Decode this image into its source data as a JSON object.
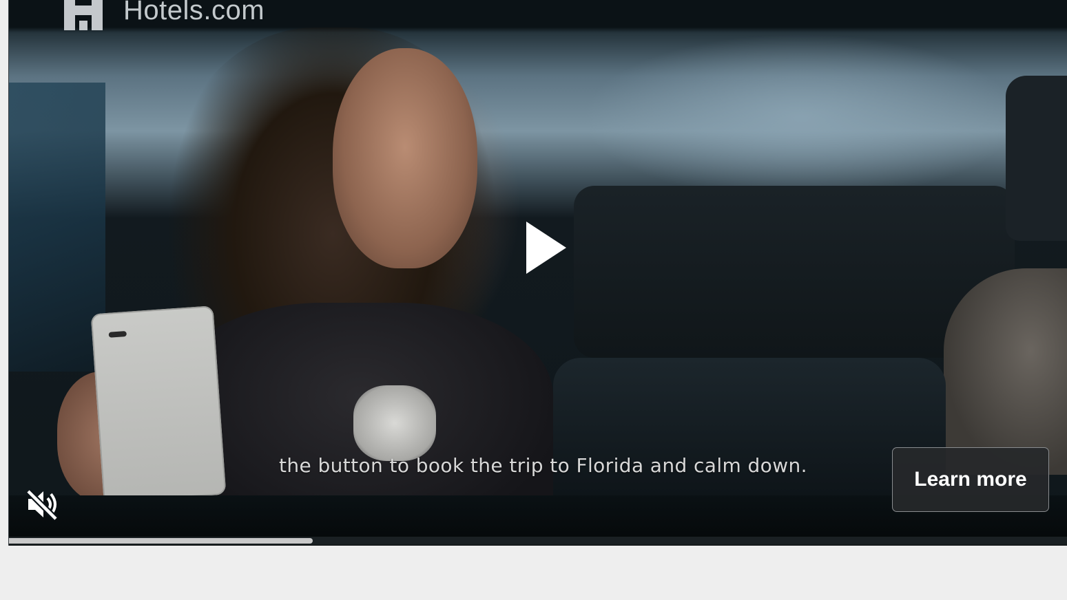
{
  "brand": {
    "name": "Hotels.com",
    "icon": "hotels-logo-icon"
  },
  "video": {
    "caption": "the button to book the trip to Florida and calm down.",
    "progress": 0.287,
    "muted": true,
    "play_icon": "play-icon",
    "mute_icon": "volume-muted-icon"
  },
  "cta": {
    "label": "Learn more"
  },
  "colors": {
    "page_background": "#eeeeee",
    "progress_fill": "#c9c9c9",
    "cta_background": "#26282a"
  }
}
